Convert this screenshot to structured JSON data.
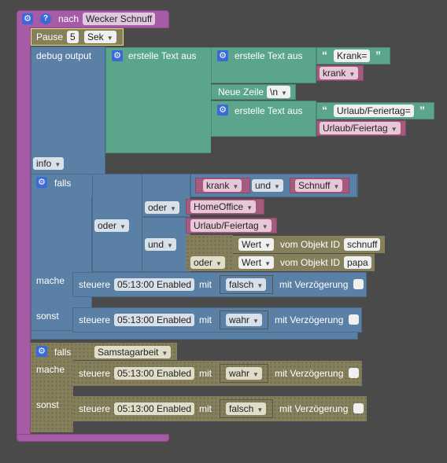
{
  "header": {
    "label": "nach",
    "value": "Wecker Schnuff"
  },
  "pause": {
    "label": "Pause",
    "value": "5",
    "unit": "Sek"
  },
  "debug": {
    "label": "debug output",
    "create_text": "erstelle Text aus",
    "krank_str": "Krank=",
    "krank_var": "krank",
    "newline_label": "Neue Zeile",
    "newline_value": "\\n",
    "urlaub_str": "Urlaub/Feriertag=",
    "urlaub_var": "Urlaub/Feiertag",
    "level": "info"
  },
  "if1": {
    "falls": "falls",
    "krank": "krank",
    "und": "und",
    "schnuff": "Schnuff",
    "oder": "oder",
    "homeoffice": "HomeOffice",
    "urlaub": "Urlaub/Feiertag",
    "wert": "Wert",
    "vom_objekt": "vom Objekt ID",
    "obj1": "schnuff",
    "obj2": "papa",
    "mache": "mache",
    "sonst": "sonst",
    "steuere": "steuere",
    "enabled": "05:13:00 Enabled",
    "mit": "mit",
    "falsch": "falsch",
    "wahr": "wahr",
    "verz": "mit Verzögerung"
  },
  "if2": {
    "falls": "falls",
    "samstag": "Samstagarbeit",
    "mache": "mache",
    "sonst": "sonst"
  },
  "colors": {
    "procedure": "#a55ba5",
    "timing": "#857f5c",
    "logic": "#5b80a5",
    "text": "#5ba58c",
    "variable": "#a55b80",
    "gear": "#3a6ad8"
  },
  "icons": [
    "gear-icon",
    "help-icon",
    "quote-icon",
    "dropdown-caret-icon"
  ]
}
